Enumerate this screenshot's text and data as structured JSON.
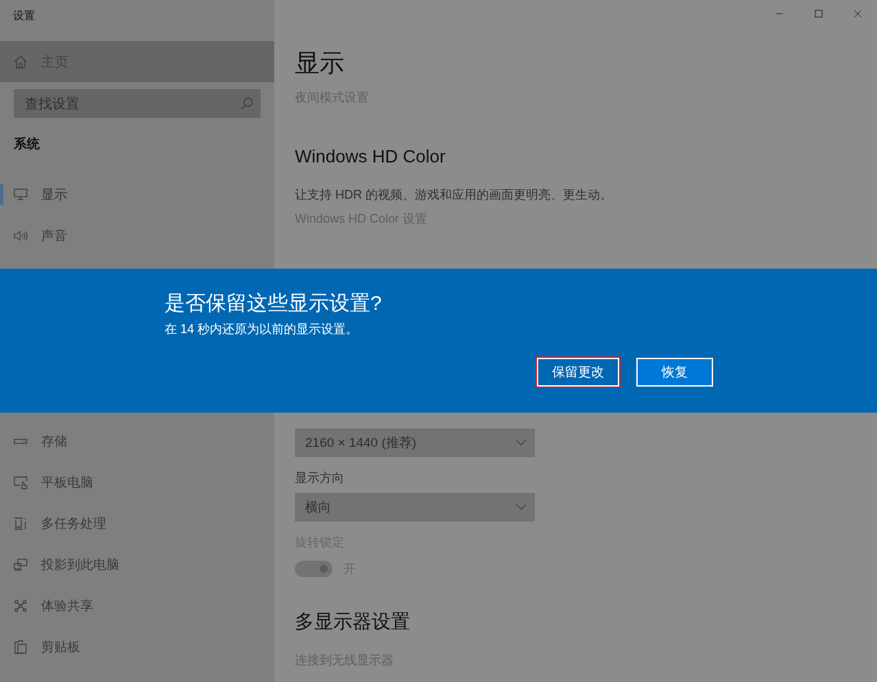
{
  "window": {
    "title": "设置"
  },
  "sidebar": {
    "home": "主页",
    "search": {
      "placeholder": "查找设置"
    },
    "section": "系统",
    "nav_items_top": [
      {
        "label": "显示",
        "selected": true
      },
      {
        "label": "声音",
        "selected": false
      }
    ],
    "nav_items_bottom": [
      {
        "label": "存储",
        "selected": false
      },
      {
        "label": "平板电脑",
        "selected": false
      },
      {
        "label": "多任务处理",
        "selected": false
      },
      {
        "label": "投影到此电脑",
        "selected": false
      },
      {
        "label": "体验共享",
        "selected": false
      },
      {
        "label": "剪贴板",
        "selected": false
      }
    ]
  },
  "main": {
    "title": "显示",
    "night_light_link": "夜间模式设置",
    "hd_color": {
      "heading": "Windows HD Color",
      "description": "让支持 HDR 的视频、游戏和应用的画面更明亮、更生动。",
      "link": "Windows HD Color 设置"
    },
    "resolution": {
      "value": "2160 × 1440 (推荐)"
    },
    "orientation": {
      "label": "显示方向",
      "value": "横向"
    },
    "rotation_lock": {
      "label": "旋转锁定",
      "on": true,
      "disabled": true,
      "state_text": "开"
    },
    "multi_display": {
      "heading": "多显示器设置",
      "link": "连接到无线显示器"
    }
  },
  "dialog": {
    "title": "是否保留这些显示设置?",
    "message": "在 14 秒内还原为以前的显示设置。",
    "buttons": [
      {
        "label": "保留更改",
        "highlighted": true
      },
      {
        "label": "恢复",
        "highlighted": false
      }
    ]
  }
}
